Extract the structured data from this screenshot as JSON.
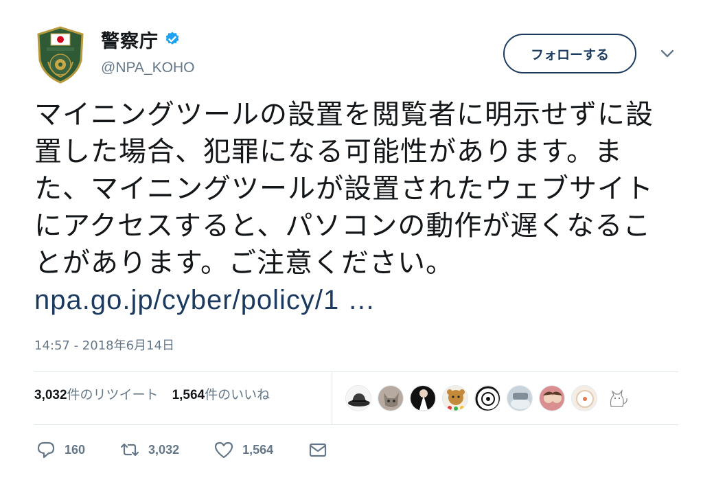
{
  "author": {
    "name": "警察庁",
    "handle": "@NPA_KOHO"
  },
  "follow_label": "フォローする",
  "tweet": {
    "text": "マイニングツールの設置を閲覧者に明示せずに設置した場合、犯罪になる可能性があります。また、マイニングツールが設置されたウェブサイトにアクセスすると、パソコンの動作が遅くなることがあります。ご注意ください。",
    "link": "npa.go.jp/cyber/policy/1 …"
  },
  "timestamp": "14:57 - 2018年6月14日",
  "stats": {
    "retweets_count": "3,032",
    "retweets_label": "件のリツイート",
    "likes_count": "1,564",
    "likes_label": "件のいいね"
  },
  "actions": {
    "reply_count": "160",
    "retweet_count": "3,032",
    "like_count": "1,564"
  },
  "colors": {
    "link": "#1b3a5e",
    "verified": "#1da1f2",
    "muted": "#657786"
  }
}
